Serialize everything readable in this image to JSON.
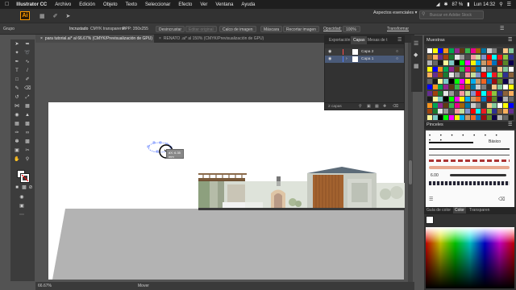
{
  "menubar": {
    "app_name": "Illustrator CC",
    "items": [
      "Archivo",
      "Edición",
      "Objeto",
      "Texto",
      "Seleccionar",
      "Efecto",
      "Ver",
      "Ventana",
      "Ayuda"
    ],
    "battery": "87 %",
    "clock": "Lun 14:32"
  },
  "appbar": {
    "logo": "Ai",
    "workspace": "Aspectos esenciales",
    "search_placeholder": "Buscar en Adobe Stock"
  },
  "controlbar": {
    "group": "Grupo",
    "embedded": "Incrustado",
    "color_mode": "CMYK transparente",
    "ppi": "PPP: 350x255",
    "unembed": "Desincrustar",
    "edit_original": "Editar original",
    "image_trace": "Calco de imagen",
    "mask": "Máscara",
    "crop_image": "Recortar imagen",
    "opacity_label": "Opacidad:",
    "opacity_value": "100%",
    "transform": "Transformar"
  },
  "tabs": [
    {
      "label": "para tutorial.ai* al 66.67% (CMYK/Previsualización de GPU)",
      "active": true
    },
    {
      "label": "RENATO .ai* al 150% (CMYK/Previsualización de GPU)",
      "active": false
    }
  ],
  "layers_panel": {
    "tabs": [
      "Exportación",
      "Capas",
      "Mesas de t"
    ],
    "active_tab": "Capas",
    "layers": [
      {
        "name": "Capa 2",
        "color": "#ff4f4f"
      },
      {
        "name": "Capa 1",
        "color": "#4f7fff"
      }
    ],
    "footer": "2 capas"
  },
  "swatches_panel": {
    "title": "Muestras"
  },
  "brushes_panel": {
    "title": "Pinceles",
    "basic_label": "Básico",
    "stroke_value": "6.00"
  },
  "bottom_panel": {
    "tabs": [
      "Guía de color",
      "Color",
      "Transparen"
    ]
  },
  "cursor_tooltip": {
    "line1": "dX: 6.35 mm",
    "line2": "dY: 0 mm"
  },
  "status": {
    "zoom": "66.67%",
    "tool": "Mover"
  }
}
